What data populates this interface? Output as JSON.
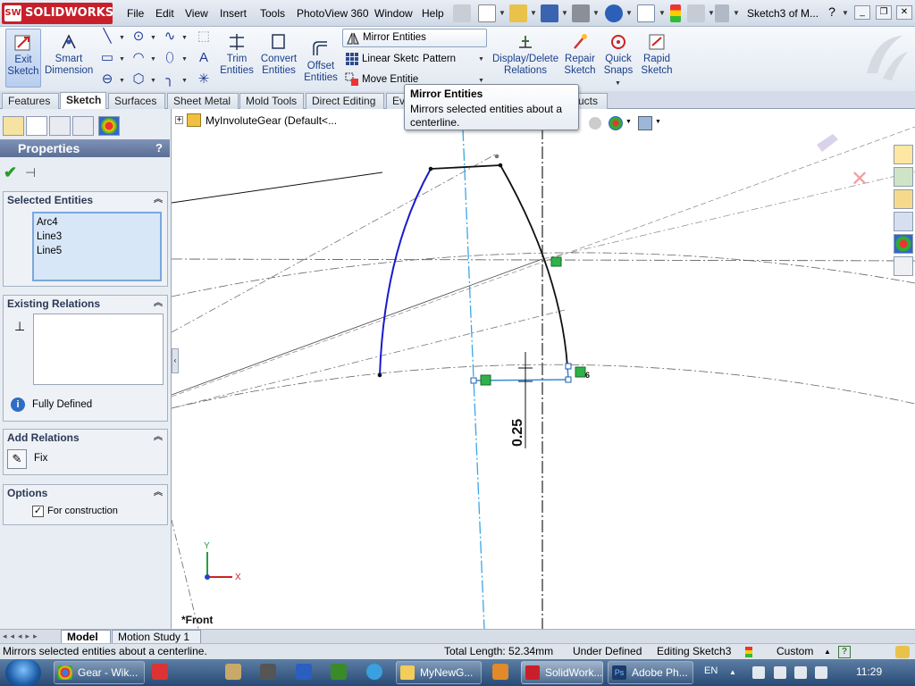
{
  "app": {
    "logo_text": "SOLIDWORKS",
    "document_title": "Sketch3 of M..."
  },
  "menu": [
    "File",
    "Edit",
    "View",
    "Insert",
    "Tools",
    "PhotoView 360",
    "Window",
    "Help"
  ],
  "command_manager": {
    "exit_sketch": "Exit\nSketch",
    "smart_dimension": "Smart\nDimension",
    "trim_entities": "Trim\nEntities",
    "convert_entities": "Convert\nEntities",
    "offset_entities": "Offset\nEntities",
    "mirror_entities": "Mirror Entities",
    "linear_sketch": "Linear Sketc",
    "pattern": "Pattern",
    "move_entities": "Move Entitie",
    "display_delete_relations": "Display/Delete\nRelations",
    "repair_sketch": "Repair\nSketch",
    "quick_snaps": "Quick\nSnaps",
    "rapid_sketch": "Rapid\nSketch"
  },
  "tabs": [
    "Features",
    "Sketch",
    "Surfaces",
    "Sheet Metal",
    "Mold Tools",
    "Direct Editing",
    "Ev",
    "ucts"
  ],
  "active_tab": "Sketch",
  "tooltip": {
    "title": "Mirror Entities",
    "body": "Mirrors selected entities about a centerline."
  },
  "feature_tree": {
    "model_name": "MyInvoluteGear  (Default<..."
  },
  "property_manager": {
    "title": "Properties",
    "help": "?",
    "selected_entities": {
      "title": "Selected Entities",
      "items": [
        "Arc4",
        "Line3",
        "Line5"
      ]
    },
    "existing_relations": {
      "title": "Existing Relations",
      "status": "Fully Defined"
    },
    "add_relations": {
      "title": "Add Relations",
      "fix_label": "Fix"
    },
    "options": {
      "title": "Options",
      "for_construction_label": "For construction",
      "for_construction_checked": true
    }
  },
  "canvas": {
    "dimension_value": "0.25",
    "view_label": "*Front",
    "relation_badge": "6",
    "axis_x": "X",
    "axis_y": "Y"
  },
  "bottom_tabs": [
    "Model",
    "Motion Study 1"
  ],
  "status_bar": {
    "message": "Mirrors selected entities about a centerline.",
    "total_length": "Total Length: 52.34mm",
    "definition": "Under Defined",
    "editing": "Editing Sketch3",
    "units": "Custom"
  },
  "taskbar": {
    "tasks": [
      "Gear - Wik...",
      "MyNewG...",
      "SolidWork...",
      "Adobe Ph..."
    ],
    "language": "EN",
    "clock": "11:29"
  }
}
